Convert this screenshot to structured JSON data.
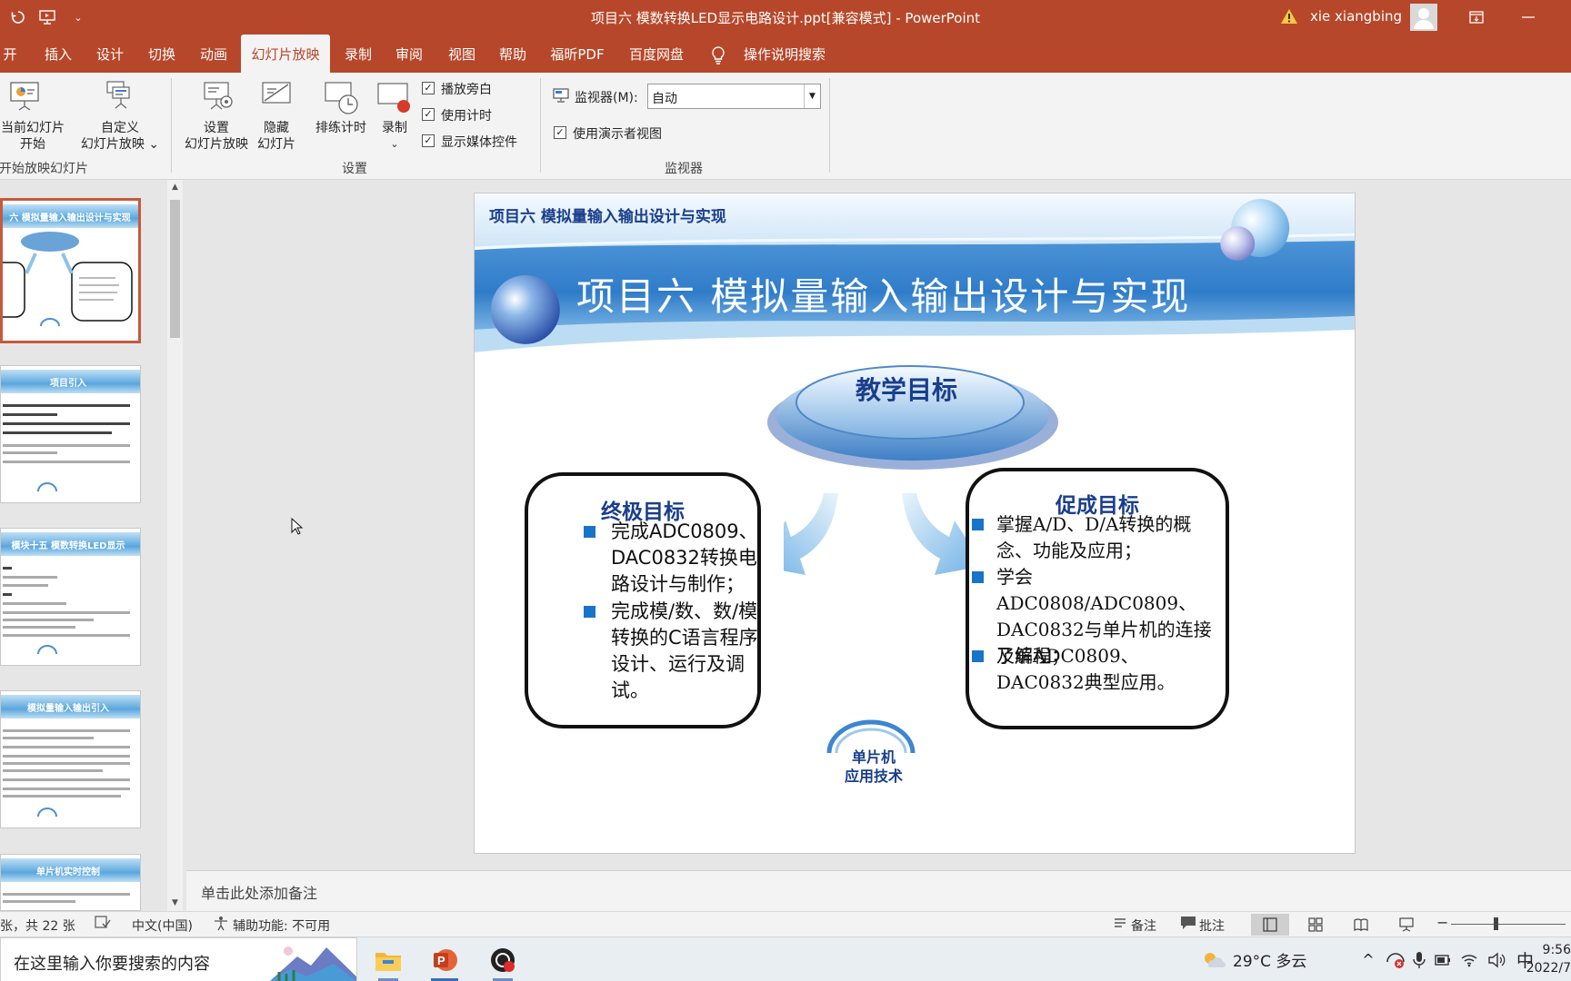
{
  "window": {
    "title": "项目六 模数转换LED显示电路设计.ppt[兼容模式]  -  PowerPoint",
    "user_name": "xie xiangbing"
  },
  "tabs": [
    {
      "label": "开始"
    },
    {
      "label": "插入"
    },
    {
      "label": "设计"
    },
    {
      "label": "切换"
    },
    {
      "label": "动画"
    },
    {
      "label": "幻灯片放映"
    },
    {
      "label": "录制"
    },
    {
      "label": "审阅"
    },
    {
      "label": "视图"
    },
    {
      "label": "帮助"
    },
    {
      "label": "福昕PDF"
    },
    {
      "label": "百度网盘"
    }
  ],
  "tell_me": "操作说明搜索",
  "ribbon": {
    "from_current_l1": "当前幻灯片",
    "from_current_l2": "开始",
    "custom_l1": "自定义",
    "custom_l2": "幻灯片放映 ⌄",
    "group_start": "开始放映幻灯片",
    "setup_l1": "设置",
    "setup_l2": "幻灯片放映",
    "hide_l1": "隐藏",
    "hide_l2": "幻灯片",
    "rehearse": "排练计时",
    "record": "录制",
    "record_caret": "⌄",
    "chk_narration": "播放旁白",
    "chk_timings": "使用计时",
    "chk_media": "显示媒体控件",
    "group_setup": "设置",
    "monitor_label": "监视器(M):",
    "monitor_value": "自动",
    "chk_presenter": "使用演示者视图",
    "group_monitor": "监视器"
  },
  "thumbnails": [
    {
      "title": "六  模拟量输入输出设计与实现"
    },
    {
      "title": "项目引入"
    },
    {
      "title": "模块十五  模数转换LED显示"
    },
    {
      "title": "模拟量输入输出引入"
    },
    {
      "title": "单片机实时控制"
    }
  ],
  "slide": {
    "small_title": "项目六  模拟量输入输出设计与实现",
    "big_title": "项目六  模拟量输入输出设计与实现",
    "goal_label": "教学目标",
    "left_heading": "终极目标",
    "left_b1": "完成ADC0809、DAC0832转换电路设计与制作；",
    "left_b2": "完成模/数、数/模转换的C语言程序设计、运行及调试。",
    "right_heading": "促成目标",
    "right_b1": "掌握A/D、D/A转换的概念、功能及应用；",
    "right_b2": "学会ADC0808/ADC0809、DAC0832与单片机的连接及编程；",
    "right_b3": "了解ADC0809、DAC0832典型应用。",
    "logo_l1": "单片机",
    "logo_l2": "应用技术"
  },
  "notes_placeholder": "单击此处添加备注",
  "status": {
    "slide_count": "张，共 22 张",
    "language": "中文(中国)",
    "accessibility": "辅助功能: 不可用",
    "notes": "备注",
    "comments": "批注"
  },
  "taskbar": {
    "search_placeholder": "在这里输入你要搜索的内容",
    "weather": "29°C  多云",
    "ime": "中",
    "time": "9:56",
    "date": "2022/7"
  },
  "colors": {
    "accent": "#b7472a",
    "slide_title_blue": "#1a3e8c",
    "bullet_blue": "#1874c9"
  }
}
